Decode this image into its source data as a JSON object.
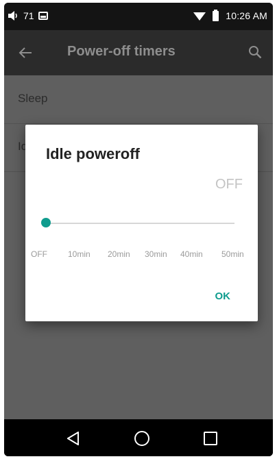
{
  "status_bar": {
    "volume_level": "71",
    "time": "10:26 AM",
    "icons": [
      "volume-icon",
      "image-icon",
      "wifi-icon",
      "battery-icon"
    ]
  },
  "app_bar": {
    "title": "Power-off timers",
    "icons": [
      "back-arrow-icon",
      "search-icon"
    ]
  },
  "list": {
    "items": [
      {
        "label": "Sleep"
      },
      {
        "label": "Id"
      }
    ]
  },
  "dialog": {
    "title": "Idle poweroff",
    "value": "OFF",
    "slider": {
      "selected_index": 0,
      "ticks": [
        "OFF",
        "10min",
        "20min",
        "30min",
        "40min",
        "50min"
      ]
    },
    "ok_label": "OK",
    "accent_color": "#0f9c8e"
  },
  "nav_bar": {
    "icons": [
      "nav-back-icon",
      "nav-home-icon",
      "nav-recents-icon"
    ]
  }
}
